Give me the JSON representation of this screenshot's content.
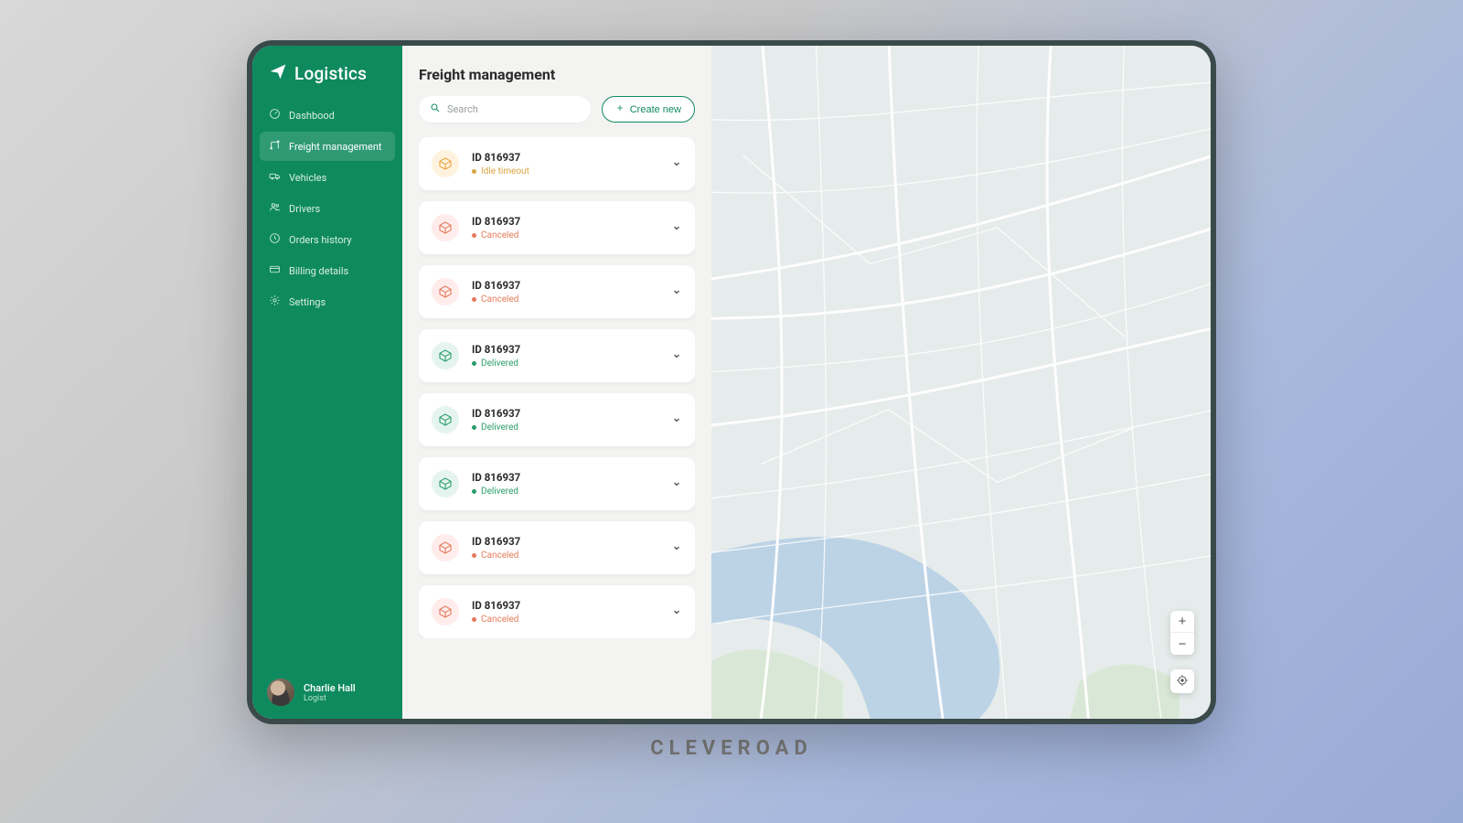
{
  "brand": "Logistics",
  "footer": "CLEVEROAD",
  "sidebar": {
    "items": [
      {
        "label": "Dashbood",
        "icon": "gauge"
      },
      {
        "label": "Freight management",
        "icon": "route",
        "active": true
      },
      {
        "label": "Vehicles",
        "icon": "truck"
      },
      {
        "label": "Drivers",
        "icon": "users"
      },
      {
        "label": "Orders history",
        "icon": "clock"
      },
      {
        "label": "Billing details",
        "icon": "card"
      },
      {
        "label": "Settings",
        "icon": "gear"
      }
    ]
  },
  "profile": {
    "name": "Charlie Hall",
    "role": "Logist"
  },
  "page": {
    "title": "Freight management"
  },
  "search": {
    "placeholder": "Search"
  },
  "create_btn": "Create new",
  "freights": [
    {
      "id": "ID 816937",
      "status": "Idle timeout",
      "kind": "idle"
    },
    {
      "id": "ID 816937",
      "status": "Canceled",
      "kind": "cancel"
    },
    {
      "id": "ID 816937",
      "status": "Canceled",
      "kind": "cancel"
    },
    {
      "id": "ID 816937",
      "status": "Delivered",
      "kind": "deliver"
    },
    {
      "id": "ID 816937",
      "status": "Delivered",
      "kind": "deliver"
    },
    {
      "id": "ID 816937",
      "status": "Delivered",
      "kind": "deliver"
    },
    {
      "id": "ID 816937",
      "status": "Canceled",
      "kind": "cancel"
    },
    {
      "id": "ID 816937",
      "status": "Canceled",
      "kind": "cancel"
    }
  ],
  "colors": {
    "brand_green": "#0f8a5f",
    "idle": "#d9a441",
    "canceled": "#e37a5c",
    "delivered": "#2a9d6c"
  }
}
